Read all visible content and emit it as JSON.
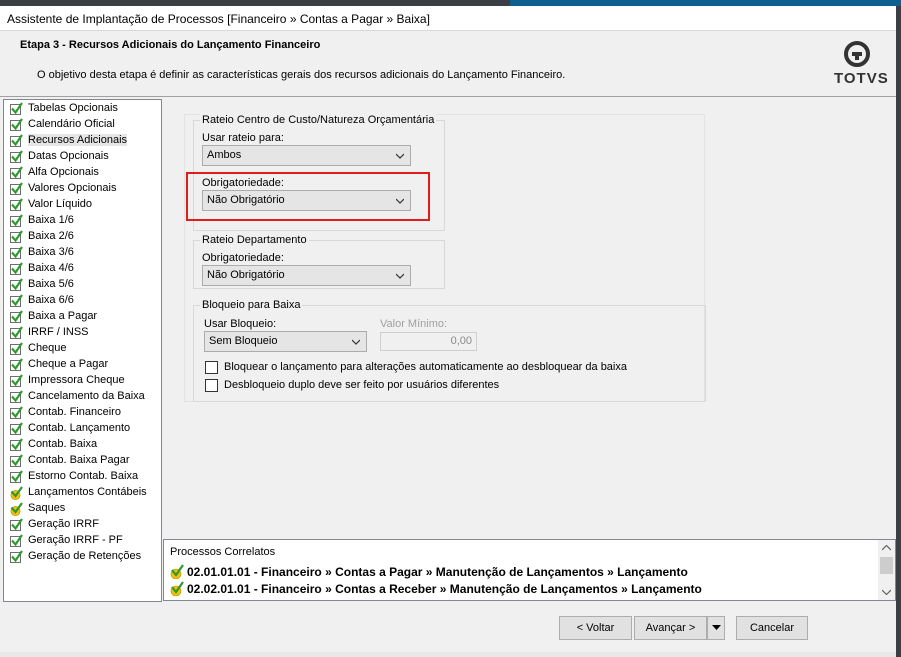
{
  "window": {
    "title": "Assistente de Implantação de Processos [Financeiro » Contas a Pagar » Baixa]"
  },
  "header": {
    "step_title": "Etapa 3 - Recursos Adicionais do Lançamento Financeiro",
    "step_desc": "O objetivo desta etapa é definir as características gerais dos recursos adicionais do Lançamento Financeiro.",
    "logo_text": "TOTVS"
  },
  "sidebar": {
    "items": [
      {
        "label": "Tabelas Opcionais",
        "icon": "check-icon"
      },
      {
        "label": "Calendário Oficial",
        "icon": "check-icon"
      },
      {
        "label": "Recursos Adicionais",
        "icon": "check-icon",
        "selected": true
      },
      {
        "label": "Datas Opcionais",
        "icon": "check-icon"
      },
      {
        "label": "Alfa Opcionais",
        "icon": "check-icon"
      },
      {
        "label": "Valores Opcionais",
        "icon": "check-icon"
      },
      {
        "label": "Valor Líquido",
        "icon": "check-icon"
      },
      {
        "label": "Baixa 1/6",
        "icon": "check-icon"
      },
      {
        "label": "Baixa 2/6",
        "icon": "check-icon"
      },
      {
        "label": "Baixa 3/6",
        "icon": "check-icon"
      },
      {
        "label": "Baixa 4/6",
        "icon": "check-icon"
      },
      {
        "label": "Baixa 5/6",
        "icon": "check-icon"
      },
      {
        "label": "Baixa 6/6",
        "icon": "check-icon"
      },
      {
        "label": "Baixa a Pagar",
        "icon": "check-icon"
      },
      {
        "label": "IRRF / INSS",
        "icon": "check-icon"
      },
      {
        "label": "Cheque",
        "icon": "check-icon"
      },
      {
        "label": "Cheque a Pagar",
        "icon": "check-icon"
      },
      {
        "label": "Impressora Cheque",
        "icon": "check-icon"
      },
      {
        "label": "Cancelamento da Baixa",
        "icon": "check-icon"
      },
      {
        "label": "Contab. Financeiro",
        "icon": "check-icon"
      },
      {
        "label": "Contab. Lançamento",
        "icon": "check-icon"
      },
      {
        "label": "Contab. Baixa",
        "icon": "check-icon"
      },
      {
        "label": "Contab. Baixa Pagar",
        "icon": "check-icon"
      },
      {
        "label": "Estorno Contab. Baixa",
        "icon": "check-icon"
      },
      {
        "label": "Lançamentos Contábeis",
        "icon": "check-warning-icon"
      },
      {
        "label": "Saques",
        "icon": "check-warning-icon"
      },
      {
        "label": "Geração IRRF",
        "icon": "check-icon"
      },
      {
        "label": "Geração IRRF - PF",
        "icon": "check-icon"
      },
      {
        "label": "Geração de Retenções",
        "icon": "check-icon"
      }
    ]
  },
  "rateio_cc": {
    "legend": "Rateio Centro de Custo/Natureza Orçamentária",
    "usar_label": "Usar rateio para:",
    "usar_value": "Ambos",
    "obrig_label": "Obrigatoriedade:",
    "obrig_value": "Não Obrigatório"
  },
  "rateio_depto": {
    "legend": "Rateio Departamento",
    "obrig_label": "Obrigatoriedade:",
    "obrig_value": "Não Obrigatório"
  },
  "bloqueio": {
    "legend": "Bloqueio para Baixa",
    "usar_label": "Usar Bloqueio:",
    "usar_value": "Sem Bloqueio",
    "valor_label": "Valor Mínimo:",
    "valor_value": "0,00",
    "cb1_label": "Bloquear o lançamento para alterações automaticamente ao desbloquear da baixa",
    "cb2_label": "Desbloqueio duplo deve ser feito por usuários diferentes"
  },
  "related": {
    "title": "Processos Correlatos",
    "items": [
      "02.01.01.01 - Financeiro » Contas a Pagar » Manutenção de Lançamentos » Lançamento",
      "02.02.01.01 - Financeiro » Contas a Receber » Manutenção de Lançamentos » Lançamento"
    ]
  },
  "buttons": {
    "back": "< Voltar",
    "next": "Avançar >",
    "cancel": "Cancelar"
  },
  "colors": {
    "highlight": "#e21b1b",
    "check_green": "#2e9a2e",
    "warning_yellow": "#f2c200"
  }
}
